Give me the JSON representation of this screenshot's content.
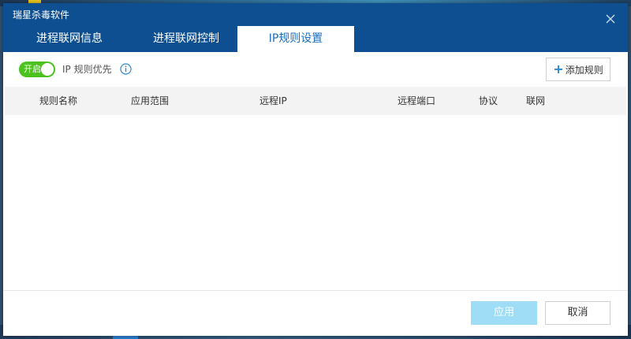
{
  "window": {
    "title": "瑞星杀毒软件"
  },
  "tabs": [
    {
      "label": "进程联网信息",
      "active": false
    },
    {
      "label": "进程联网控制",
      "active": false
    },
    {
      "label": "IP规则设置",
      "active": true
    }
  ],
  "toolbar": {
    "toggle_label": "开启",
    "toggle_on": true,
    "priority_label": "IP 规则优先",
    "add_rule_label": "添加规则"
  },
  "table": {
    "columns": [
      "规则名称",
      "应用范围",
      "远程IP",
      "远程端口",
      "协议",
      "联网"
    ],
    "rows": []
  },
  "footer": {
    "apply_label": "应用",
    "apply_enabled": false,
    "cancel_label": "取消"
  },
  "colors": {
    "titlebar": "#0e4f91",
    "active_tab_text": "#1a6ec0",
    "toggle_on": "#4cc21f",
    "apply_disabled": "#9fdcf5"
  },
  "icons": [
    "close-icon",
    "info-icon",
    "plus-icon"
  ]
}
